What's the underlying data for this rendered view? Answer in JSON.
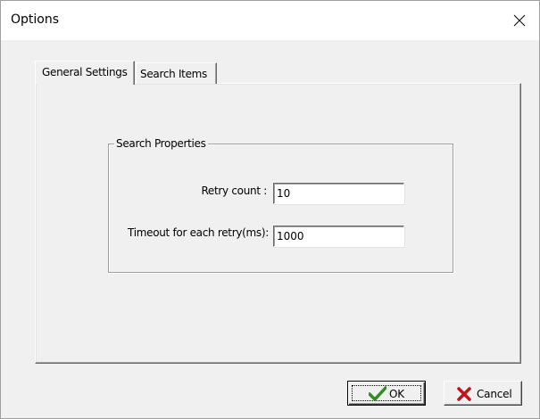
{
  "window": {
    "title": "Options"
  },
  "tabs": [
    {
      "label": "General Settings",
      "active": true
    },
    {
      "label": "Search Items",
      "active": false
    }
  ],
  "search_properties": {
    "group_title": "Search Properties",
    "retry_count": {
      "label": "Retry count :",
      "value": "10"
    },
    "timeout": {
      "label": "Timeout for each retry(ms):",
      "value": "1000"
    }
  },
  "buttons": {
    "ok": {
      "label": "OK",
      "icon": "checkmark-icon",
      "color": "#2f8f1f"
    },
    "cancel": {
      "label": "Cancel",
      "icon": "x-icon",
      "color": "#c0141c"
    }
  }
}
